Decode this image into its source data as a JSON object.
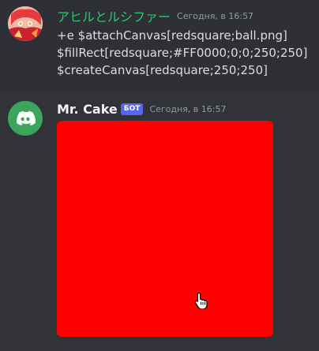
{
  "messages": [
    {
      "username": "アヒルとルシファー",
      "timestamp": "Сегодня, в 16:57",
      "avatar_icon": "anime-character-avatar",
      "lines": [
        "+e $attachCanvas[redsquare;ball.png]",
        "$fillRect[redsquare;#FF0000;0;0;250;250]",
        "$createCanvas[redsquare;250;250]"
      ]
    },
    {
      "username": "Mr. Cake",
      "badge": "БОТ",
      "timestamp": "Сегодня, в 16:57",
      "avatar_icon": "discord-logo-icon",
      "attachment": {
        "fill_color": "#FF0000"
      }
    }
  ],
  "colors": {
    "background": "#313338",
    "highlight_row": "#2e3035",
    "username_green": "#2dc770",
    "bot_badge": "#5865f2",
    "avatar_green": "#3ba55c"
  }
}
